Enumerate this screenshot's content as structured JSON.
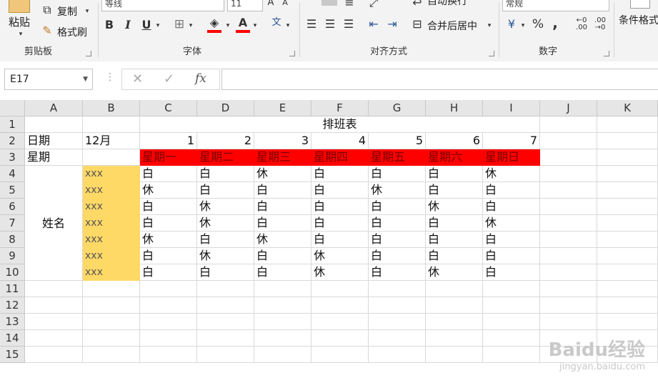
{
  "ribbon": {
    "clipboard": {
      "paste": "粘贴",
      "copy": "复制",
      "format_painter": "格式刷",
      "label": "剪贴板"
    },
    "font": {
      "font_name": "等线",
      "font_size": "11",
      "bold": "B",
      "italic": "I",
      "underline": "U",
      "label": "字体"
    },
    "alignment": {
      "wrap_text": "自动换行",
      "merge_center": "合并后居中",
      "label": "对齐方式"
    },
    "number": {
      "format": "常规",
      "percent": "%",
      "comma": ",",
      "label": "数字"
    },
    "styles": {
      "conditional": "条件格式"
    }
  },
  "formula_bar": {
    "name_box": "E17",
    "fx": "fx",
    "value": ""
  },
  "sheet": {
    "columns": [
      "A",
      "B",
      "C",
      "D",
      "E",
      "F",
      "G",
      "H",
      "I",
      "J",
      "K"
    ],
    "rows": [
      "1",
      "2",
      "3",
      "4",
      "5",
      "6",
      "7",
      "8",
      "9",
      "10",
      "11",
      "12",
      "13",
      "14",
      "15"
    ],
    "title": "排班表",
    "date_label": "日期",
    "month": "12月",
    "weekday_label": "星期",
    "name_label": "姓名",
    "days": [
      "1",
      "2",
      "3",
      "4",
      "5",
      "6",
      "7"
    ],
    "weekdays": [
      "星期一",
      "星期二",
      "星期三",
      "星期四",
      "星期五",
      "星期六",
      "星期日"
    ],
    "employees": [
      "xxx",
      "xxx",
      "xxx",
      "xxx",
      "xxx",
      "xxx",
      "xxx"
    ],
    "schedule": [
      [
        "白",
        "白",
        "休",
        "白",
        "白",
        "白",
        "休"
      ],
      [
        "休",
        "白",
        "白",
        "白",
        "休",
        "白",
        "白"
      ],
      [
        "白",
        "休",
        "白",
        "白",
        "白",
        "休",
        "白"
      ],
      [
        "白",
        "休",
        "白",
        "白",
        "白",
        "白",
        "休"
      ],
      [
        "休",
        "白",
        "休",
        "白",
        "白",
        "白",
        "白"
      ],
      [
        "白",
        "休",
        "白",
        "休",
        "白",
        "白",
        "白"
      ],
      [
        "白",
        "白",
        "白",
        "休",
        "白",
        "休",
        "白"
      ]
    ]
  },
  "colors": {
    "weekday_fill": "#ff0000",
    "name_fill": "#ffd966"
  },
  "watermark": {
    "brand": "Baidu经验",
    "url": "jingyan.baidu.com"
  }
}
